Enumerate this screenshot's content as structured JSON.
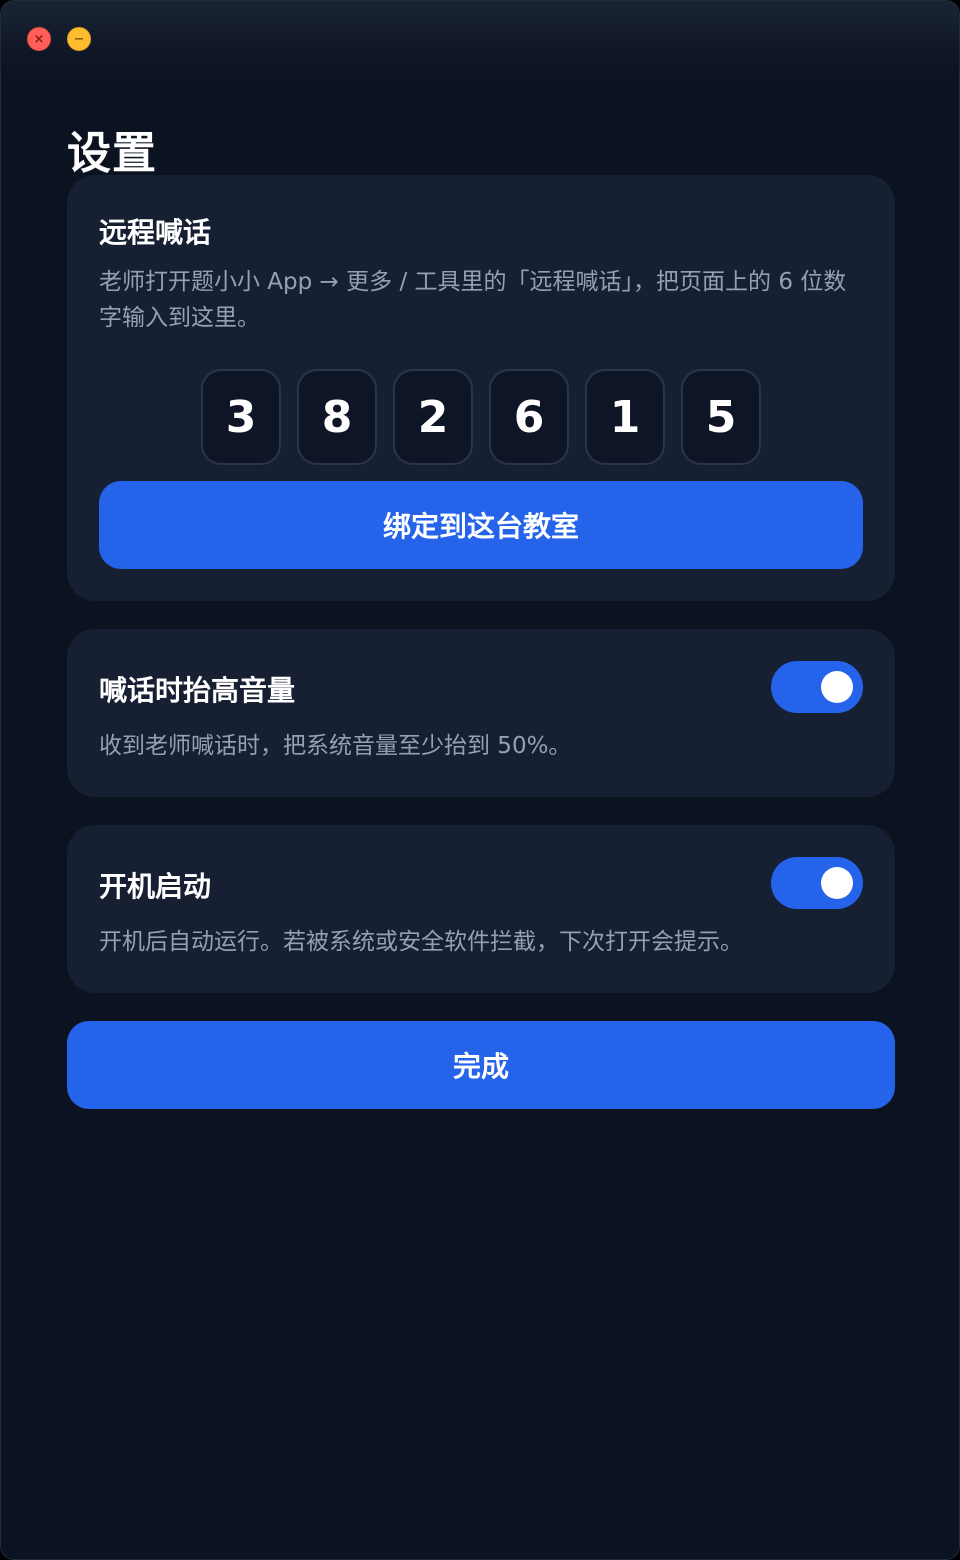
{
  "window": {
    "controls": {
      "close_glyph": "×",
      "minimize_glyph": "−"
    }
  },
  "page": {
    "title": "设置"
  },
  "remote_call": {
    "title": "远程喊话",
    "description": "老师打开题小小 App → 更多 / 工具里的「远程喊话」，把页面上的 6 位数字输入到这里。",
    "code_digits": [
      "3",
      "8",
      "2",
      "6",
      "1",
      "5"
    ],
    "bind_button_label": "绑定到这台教室"
  },
  "raise_volume": {
    "title": "喊话时抬高音量",
    "description": "收到老师喊话时，把系统音量至少抬到 50%。",
    "enabled": true
  },
  "launch_at_startup": {
    "title": "开机启动",
    "description": "开机后自动运行。若被系统或安全软件拦截，下次打开会提示。",
    "enabled": true
  },
  "done_button_label": "完成",
  "colors": {
    "window_bg": "#0b1220",
    "card_bg": "#172032",
    "accent": "#2563eb",
    "muted_text": "#94a0b3"
  }
}
